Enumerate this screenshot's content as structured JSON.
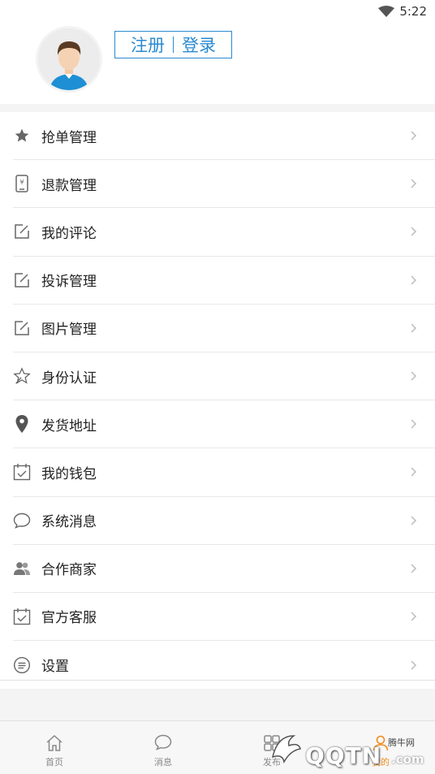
{
  "status_bar": {
    "time": "5:22",
    "wifi_icon": "wifi-icon"
  },
  "header": {
    "register_label": "注册",
    "login_label": "登录",
    "accent_color": "#2a8ad1"
  },
  "menu": {
    "items": [
      {
        "label": "抢单管理",
        "icon": "star-icon"
      },
      {
        "label": "退款管理",
        "icon": "phone-yen-icon"
      },
      {
        "label": "我的评论",
        "icon": "edit-icon"
      },
      {
        "label": "投诉管理",
        "icon": "edit-icon"
      },
      {
        "label": "图片管理",
        "icon": "edit-icon"
      },
      {
        "label": "身份认证",
        "icon": "star-outline-icon"
      },
      {
        "label": "发货地址",
        "icon": "location-pin-icon"
      },
      {
        "label": "我的钱包",
        "icon": "calendar-check-icon"
      },
      {
        "label": "系统消息",
        "icon": "chat-bubble-icon"
      },
      {
        "label": "合作商家",
        "icon": "users-icon"
      },
      {
        "label": "官方客服",
        "icon": "calendar-check-icon"
      },
      {
        "label": "设置",
        "icon": "settings-bubble-icon"
      }
    ]
  },
  "tabbar": {
    "tabs": [
      {
        "label": "首页",
        "icon": "home-icon"
      },
      {
        "label": "消息",
        "icon": "message-icon"
      },
      {
        "label": "发布",
        "icon": "publish-icon"
      },
      {
        "label": "我的",
        "icon": "profile-icon"
      }
    ]
  },
  "watermark": {
    "text": "QQTN",
    "cn_text": "腾牛网",
    "com_text": ".com"
  }
}
